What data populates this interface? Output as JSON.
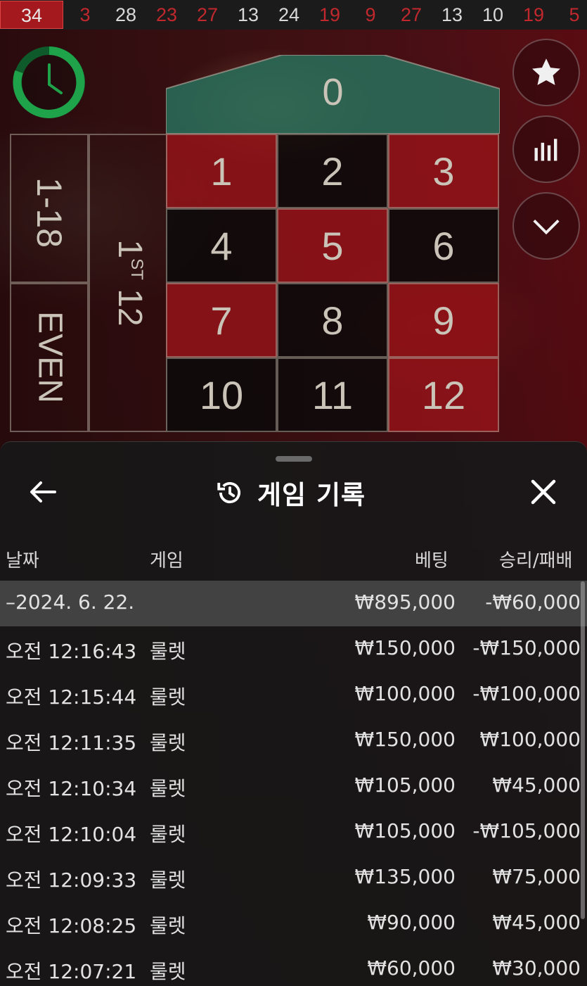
{
  "recent_numbers": [
    {
      "value": "34",
      "color": "red"
    },
    {
      "value": "3",
      "color": "red"
    },
    {
      "value": "28",
      "color": "black"
    },
    {
      "value": "23",
      "color": "red"
    },
    {
      "value": "27",
      "color": "red"
    },
    {
      "value": "13",
      "color": "black"
    },
    {
      "value": "24",
      "color": "black"
    },
    {
      "value": "19",
      "color": "red"
    },
    {
      "value": "9",
      "color": "red"
    },
    {
      "value": "27",
      "color": "red"
    },
    {
      "value": "13",
      "color": "black"
    },
    {
      "value": "10",
      "color": "black"
    },
    {
      "value": "19",
      "color": "red"
    },
    {
      "value": "5",
      "color": "red"
    }
  ],
  "table": {
    "zero": "0",
    "numbers": [
      {
        "n": "1",
        "color": "red"
      },
      {
        "n": "2",
        "color": "black"
      },
      {
        "n": "3",
        "color": "red"
      },
      {
        "n": "4",
        "color": "black"
      },
      {
        "n": "5",
        "color": "red"
      },
      {
        "n": "6",
        "color": "black"
      },
      {
        "n": "7",
        "color": "red"
      },
      {
        "n": "8",
        "color": "black"
      },
      {
        "n": "9",
        "color": "red"
      },
      {
        "n": "10",
        "color": "black"
      },
      {
        "n": "11",
        "color": "black"
      },
      {
        "n": "12",
        "color": "red"
      }
    ],
    "bet_1_18": "1-18",
    "bet_even": "EVEN",
    "dozen_num": "1",
    "dozen_sup": "ST",
    "dozen_12": "12"
  },
  "side_buttons": [
    "star-icon",
    "stats-icon",
    "chevron-down-icon"
  ],
  "colors": {
    "red": "#c0282d",
    "green_timer": "#1fa34a",
    "zero_green": "#2c6b5c"
  },
  "history": {
    "title": "게임 기록",
    "columns": {
      "date": "날짜",
      "game": "게임",
      "bet": "베팅",
      "result": "승리/패배"
    },
    "date_group": {
      "date": "–2024. 6. 22.",
      "bet": "₩895,000",
      "result": "-₩60,000"
    },
    "rows": [
      {
        "time": "오전 12:16:43",
        "game": "룰렛",
        "bet": "₩150,000",
        "result": "-₩150,000"
      },
      {
        "time": "오전 12:15:44",
        "game": "룰렛",
        "bet": "₩100,000",
        "result": "-₩100,000"
      },
      {
        "time": "오전 12:11:35",
        "game": "룰렛",
        "bet": "₩150,000",
        "result": "₩100,000"
      },
      {
        "time": "오전 12:10:34",
        "game": "룰렛",
        "bet": "₩105,000",
        "result": "₩45,000"
      },
      {
        "time": "오전 12:10:04",
        "game": "룰렛",
        "bet": "₩105,000",
        "result": "-₩105,000"
      },
      {
        "time": "오전 12:09:33",
        "game": "룰렛",
        "bet": "₩135,000",
        "result": "₩75,000"
      },
      {
        "time": "오전 12:08:25",
        "game": "룰렛",
        "bet": "₩90,000",
        "result": "₩45,000"
      },
      {
        "time": "오전 12:07:21",
        "game": "룰렛",
        "bet": "₩60,000",
        "result": "₩30,000"
      }
    ]
  }
}
